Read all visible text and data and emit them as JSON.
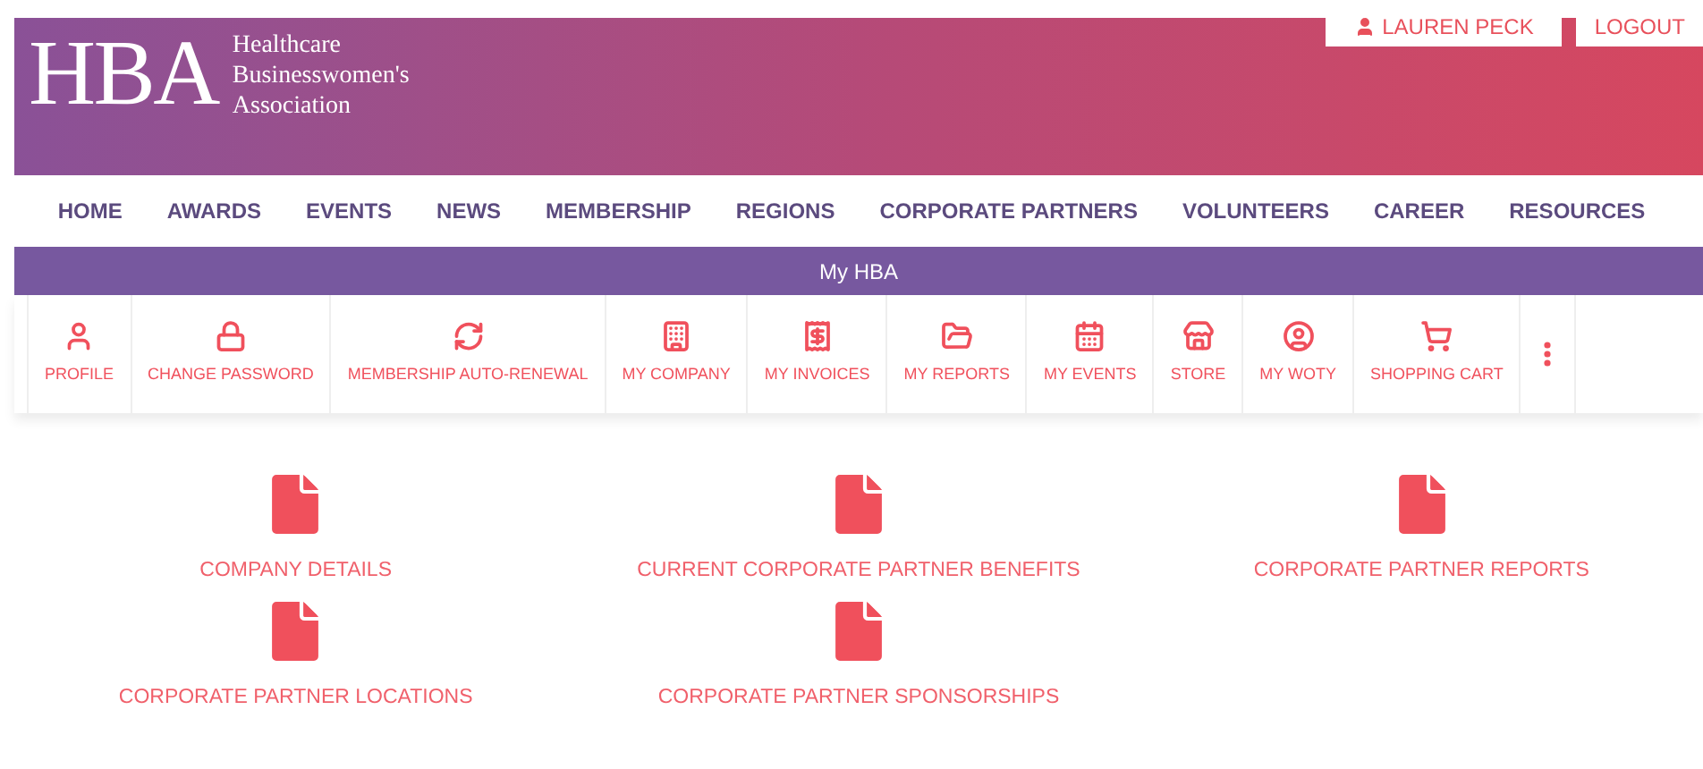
{
  "header": {
    "logo": "HBA",
    "tagline": [
      "Healthcare",
      "Businesswomen's",
      "Association"
    ],
    "user_button": "LAUREN PECK",
    "logout_button": "LOGOUT"
  },
  "nav": [
    {
      "label": "HOME"
    },
    {
      "label": "AWARDS"
    },
    {
      "label": "EVENTS"
    },
    {
      "label": "NEWS"
    },
    {
      "label": "MEMBERSHIP"
    },
    {
      "label": "REGIONS"
    },
    {
      "label": "CORPORATE PARTNERS"
    },
    {
      "label": "VOLUNTEERS"
    },
    {
      "label": "CAREER"
    },
    {
      "label": "RESOURCES"
    }
  ],
  "section_bar": "My HBA",
  "toolbar": [
    {
      "kind": "profile",
      "label": "PROFILE"
    },
    {
      "kind": "password",
      "label": "CHANGE PASSWORD"
    },
    {
      "kind": "renewal",
      "label": "MEMBERSHIP AUTO-RENEWAL"
    },
    {
      "kind": "company",
      "label": "MY COMPANY"
    },
    {
      "kind": "invoices",
      "label": "MY INVOICES"
    },
    {
      "kind": "reports",
      "label": "MY REPORTS"
    },
    {
      "kind": "events",
      "label": "MY EVENTS"
    },
    {
      "kind": "store",
      "label": "STORE"
    },
    {
      "kind": "woty",
      "label": "MY WOTY"
    },
    {
      "kind": "cart",
      "label": "SHOPPING CART"
    },
    {
      "kind": "more"
    }
  ],
  "documents": [
    {
      "label": "COMPANY DETAILS"
    },
    {
      "label": "CURRENT CORPORATE PARTNER BENEFITS"
    },
    {
      "label": "CORPORATE PARTNER REPORTS"
    },
    {
      "label": "CORPORATE PARTNER LOCATIONS"
    },
    {
      "label": "CORPORATE PARTNER SPONSORSHIPS"
    }
  ]
}
